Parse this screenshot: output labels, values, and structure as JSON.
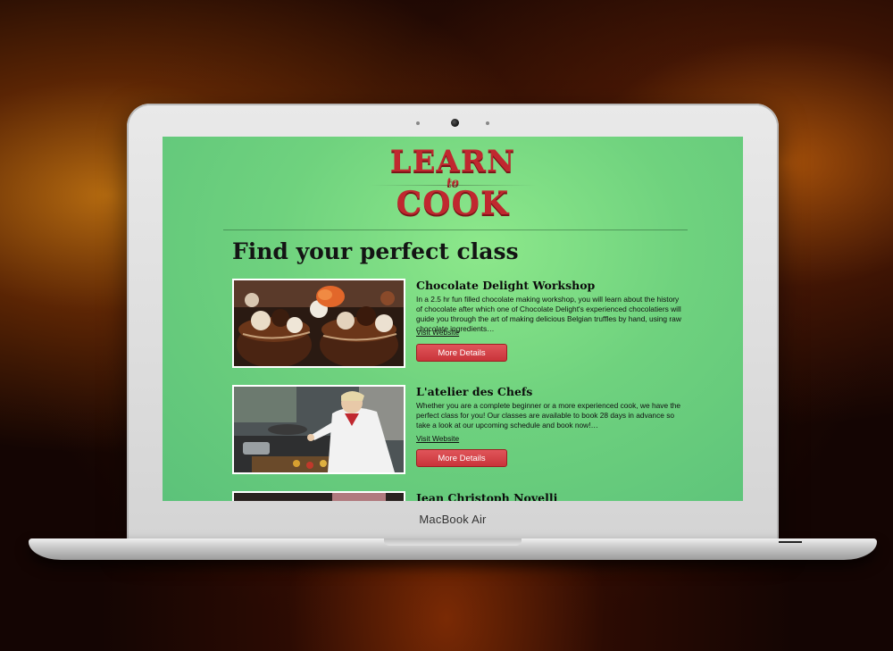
{
  "device": {
    "brand_label": "MacBook Air"
  },
  "site": {
    "logo": {
      "line1": "LEARN",
      "small": "to",
      "line2": "COOK",
      "color": "#c0282f"
    },
    "heading": "Find your perfect class"
  },
  "classes": [
    {
      "title": "Chocolate Delight Workshop",
      "description": "In a 2.5 hr fun filled chocolate making workshop, you will learn about the history of chocolate after which one of Chocolate Delight's experienced chocolatiers will guide you through the art of making delicious Belgian truffles by hand, using raw chocolate ingredients…",
      "link": "Visit Website",
      "button": "More Details",
      "image": "chocolate-truffles-photo"
    },
    {
      "title": "L'atelier des Chefs",
      "description": "Whether you are a complete beginner or a more experienced cook, we have the perfect class for you! Our classes are available to book 28 days in advance so take a look at our upcoming schedule and book now!…",
      "link": "Visit Website",
      "button": "More Details",
      "image": "chef-cooking-photo"
    },
    {
      "title": "Jean Christoph Novelli",
      "image": "novelli-photo"
    }
  ],
  "colors": {
    "screen_bg": "#6fd27e",
    "button": "#d0393f",
    "accent": "#c0282f"
  }
}
